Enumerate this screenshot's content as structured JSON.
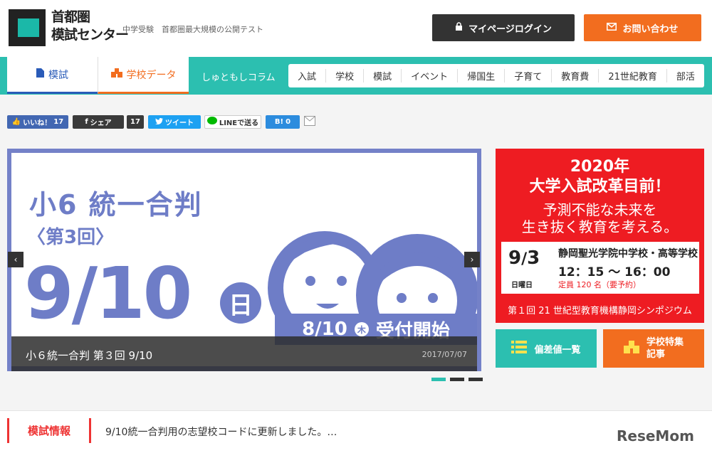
{
  "header": {
    "logo_line1": "首都圏",
    "logo_line2": "模試センター",
    "tagline": "中学受験　首都圏最大規模の公開テスト",
    "mypage_label": "マイページログイン",
    "contact_label": "お問い合わせ"
  },
  "nav": {
    "tabs": [
      {
        "label": "模試",
        "icon": "document-icon"
      },
      {
        "label": "学校データ",
        "icon": "school-icon"
      }
    ],
    "column_label": "しゅともしコラム",
    "column_items": [
      "入試",
      "学校",
      "模試",
      "イベント",
      "帰国生",
      "子育て",
      "教育費",
      "21世紀教育",
      "部活"
    ]
  },
  "social": {
    "like_label": "いいね！",
    "like_count": "17",
    "share_label": "シェア",
    "share_count": "17",
    "tweet_label": "ツイート",
    "line_label": "LINEで送る",
    "hatena_label": "B!",
    "hatena_count": "0"
  },
  "slider": {
    "title": "小6 統一合判",
    "subtitle": "〈第3回〉",
    "date": "9/10",
    "day": "日",
    "accept_date": "8/10",
    "accept_day": "木",
    "accept_label": "受付開始",
    "caption": "小６統一合判 第３回 9/10",
    "caption_date": "2017/07/07",
    "dots_total": 3,
    "active_dot": 1
  },
  "ad": {
    "title_line1": "2020年",
    "title_line2": "大学入試改革目前！",
    "sub_line1": "予測不能な未来を",
    "sub_line2": "生き抜く教育を考える。",
    "date_month": "9",
    "date_day": "3",
    "weekday": "日曜日",
    "school": "静岡聖光学院中学校・高等学校",
    "time": "12：15 〜 16：00",
    "capacity": "定員 120 名（要予約）",
    "footer": "第１回 21 世紀型教育機構静岡シンポジウム",
    "color": "#ee1c22"
  },
  "quicklinks": {
    "deviation_label": "偏差値一覧",
    "feature_line1": "学校特集",
    "feature_line2": "記事"
  },
  "news": {
    "label": "模試情報",
    "text": "9/10統一合判用の志望校コードに更新しました。…"
  },
  "watermark": "ReseMom",
  "colors": {
    "teal": "#2cbfb0",
    "orange": "#f26d1f",
    "slide_blue": "#6e7dc7",
    "dark": "#333333"
  }
}
